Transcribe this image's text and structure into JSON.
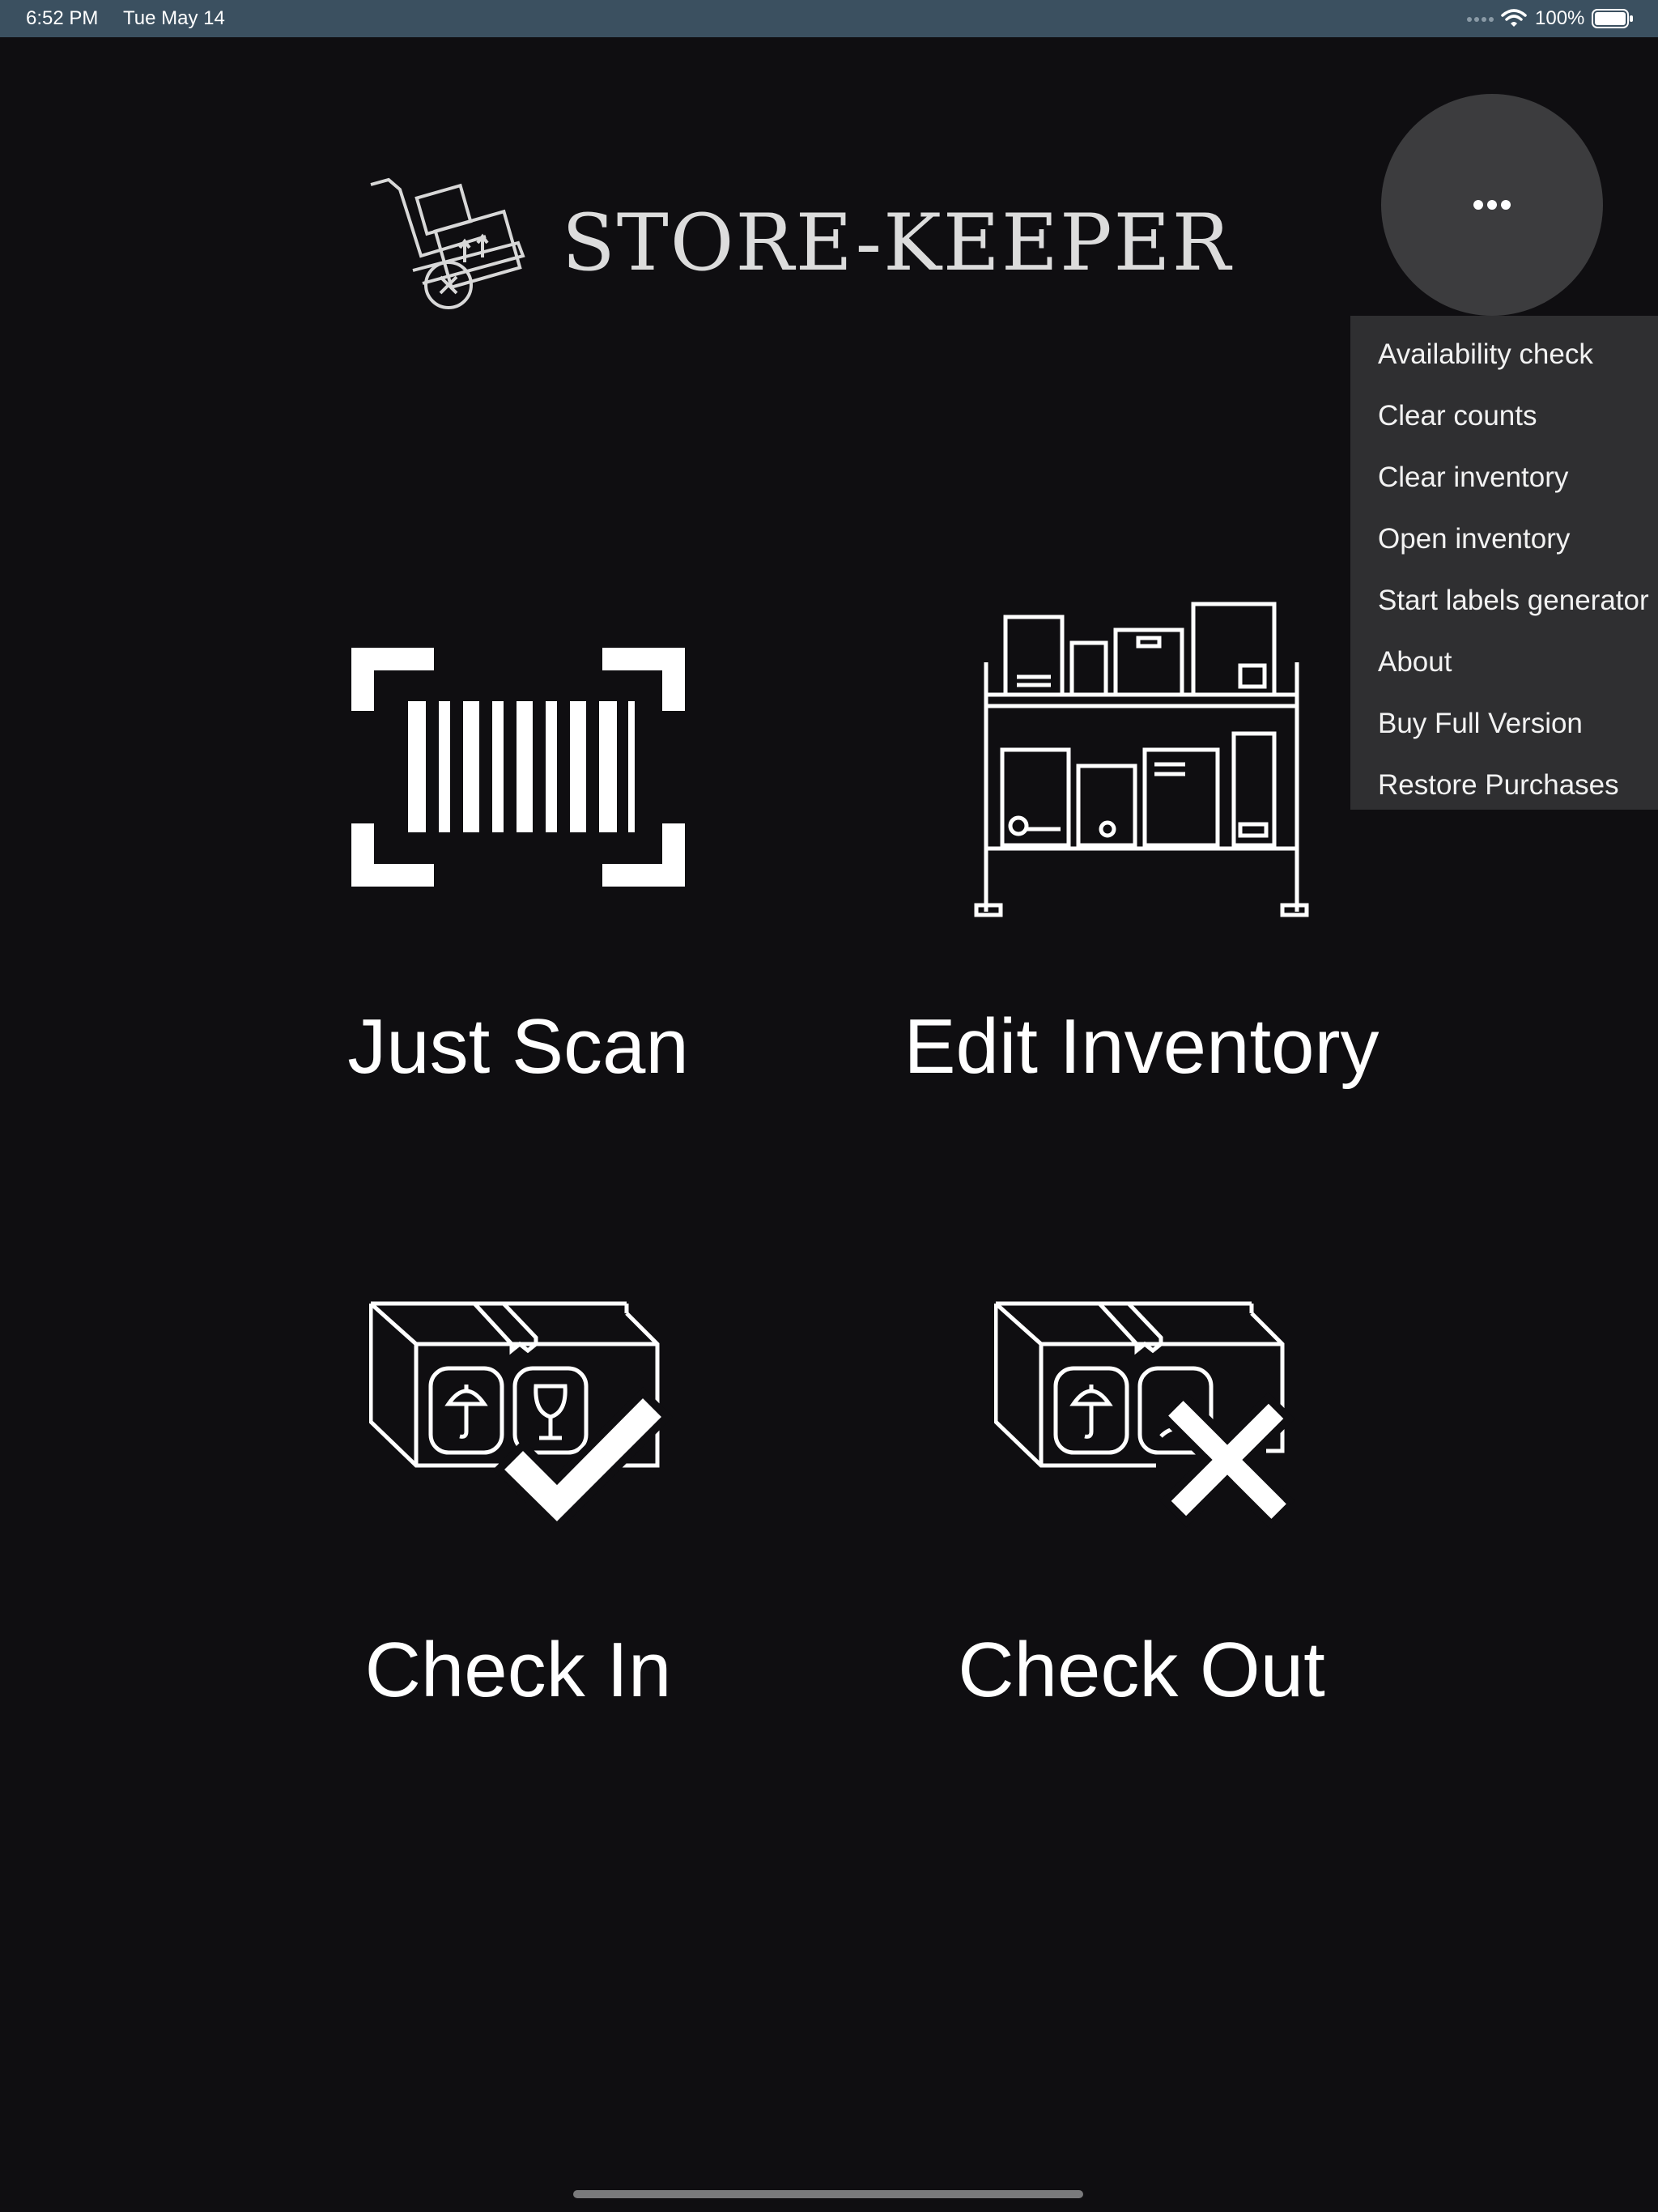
{
  "status_bar": {
    "time": "6:52 PM",
    "date": "Tue May 14",
    "battery": "100%",
    "icons": [
      "signal-dots-icon",
      "wifi-icon",
      "battery-icon"
    ]
  },
  "app": {
    "logo_text": "STORE-KEEPER",
    "logo_icon": "hand-truck-icon"
  },
  "more_button": {
    "icon": "ellipsis-icon"
  },
  "menu": {
    "items": [
      "Availability check",
      "Clear counts",
      "Clear inventory",
      "Open inventory",
      "Start labels generator",
      "About",
      "Buy Full Version",
      "Restore Purchases"
    ]
  },
  "tiles": [
    {
      "label": "Just Scan",
      "icon": "barcode-scan-icon"
    },
    {
      "label": "Edit Inventory",
      "icon": "inventory-shelf-icon"
    },
    {
      "label": "Check In",
      "icon": "box-check-icon"
    },
    {
      "label": "Check Out",
      "icon": "box-x-icon"
    }
  ],
  "colors": {
    "background": "#0f0e11",
    "status_bar": "#3b5060",
    "menu_background": "#2f2f31",
    "more_button": "#3c3c3e"
  }
}
